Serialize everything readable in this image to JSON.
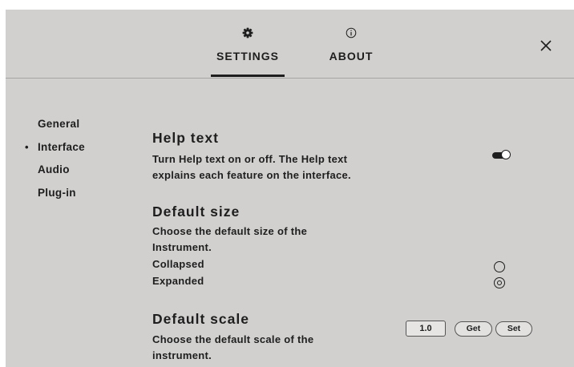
{
  "tabs": [
    {
      "label": "SETTINGS",
      "icon": "gear-icon",
      "active": true
    },
    {
      "label": "ABOUT",
      "icon": "info-icon",
      "active": false
    }
  ],
  "close_icon": "close-icon",
  "sidebar": {
    "items": [
      {
        "label": "General",
        "active": false
      },
      {
        "label": "Interface",
        "active": true
      },
      {
        "label": "Audio",
        "active": false
      },
      {
        "label": "Plug-in",
        "active": false
      }
    ]
  },
  "help_text": {
    "title": "Help text",
    "desc_line1": "Turn Help text on or off. The Help text",
    "desc_line2": "explains each feature on the interface.",
    "enabled": true
  },
  "default_size": {
    "title": "Default size",
    "desc_line1": "Choose the default size of the",
    "desc_line2": "Instrument.",
    "options": [
      {
        "label": "Collapsed",
        "selected": false
      },
      {
        "label": "Expanded",
        "selected": true
      }
    ]
  },
  "default_scale": {
    "title": "Default scale",
    "desc_line1": "Choose the default scale of the",
    "desc_line2": "instrument.",
    "value": "1.0",
    "get_label": "Get",
    "set_label": "Set"
  },
  "colors": {
    "panel_bg": "#d1d0cf",
    "text": "#1e1e1e",
    "accent": "#1e1e1e"
  }
}
